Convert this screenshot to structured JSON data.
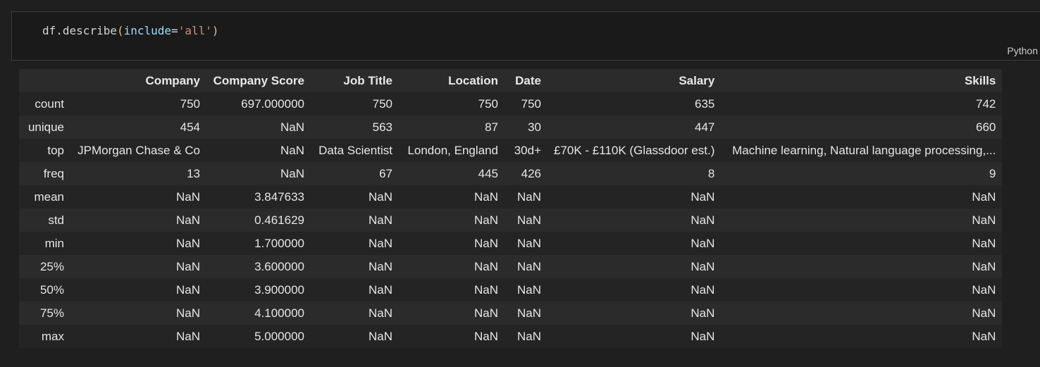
{
  "code_cell": {
    "tokens": {
      "obj": "df",
      "dot": ".",
      "method": "describe",
      "open_paren": "(",
      "kwarg": "include",
      "eq": "=",
      "str": "'all'",
      "close_paren": ")"
    },
    "language": "Python"
  },
  "table": {
    "columns": [
      "",
      "Company",
      "Company Score",
      "Job Title",
      "Location",
      "Date",
      "Salary",
      "Skills"
    ],
    "rows": [
      {
        "index": "count",
        "cells": [
          "750",
          "697.000000",
          "750",
          "750",
          "750",
          "635",
          "742"
        ]
      },
      {
        "index": "unique",
        "cells": [
          "454",
          "NaN",
          "563",
          "87",
          "30",
          "447",
          "660"
        ]
      },
      {
        "index": "top",
        "cells": [
          "JPMorgan Chase & Co",
          "NaN",
          "Data Scientist",
          "London, England",
          "30d+",
          "£70K - £110K (Glassdoor est.)",
          "Machine learning, Natural language processing,..."
        ]
      },
      {
        "index": "freq",
        "cells": [
          "13",
          "NaN",
          "67",
          "445",
          "426",
          "8",
          "9"
        ]
      },
      {
        "index": "mean",
        "cells": [
          "NaN",
          "3.847633",
          "NaN",
          "NaN",
          "NaN",
          "NaN",
          "NaN"
        ]
      },
      {
        "index": "std",
        "cells": [
          "NaN",
          "0.461629",
          "NaN",
          "NaN",
          "NaN",
          "NaN",
          "NaN"
        ]
      },
      {
        "index": "min",
        "cells": [
          "NaN",
          "1.700000",
          "NaN",
          "NaN",
          "NaN",
          "NaN",
          "NaN"
        ]
      },
      {
        "index": "25%",
        "cells": [
          "NaN",
          "3.600000",
          "NaN",
          "NaN",
          "NaN",
          "NaN",
          "NaN"
        ]
      },
      {
        "index": "50%",
        "cells": [
          "NaN",
          "3.900000",
          "NaN",
          "NaN",
          "NaN",
          "NaN",
          "NaN"
        ]
      },
      {
        "index": "75%",
        "cells": [
          "NaN",
          "4.100000",
          "NaN",
          "NaN",
          "NaN",
          "NaN",
          "NaN"
        ]
      },
      {
        "index": "max",
        "cells": [
          "NaN",
          "5.000000",
          "NaN",
          "NaN",
          "NaN",
          "NaN",
          "NaN"
        ]
      }
    ]
  }
}
